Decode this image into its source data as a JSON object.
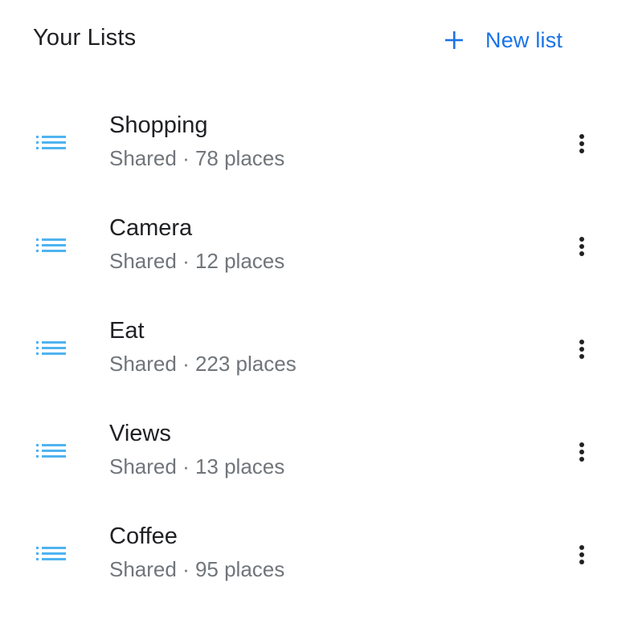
{
  "header": {
    "title": "Your Lists",
    "new_list_label": "New list",
    "new_list_icon": "plus-icon"
  },
  "colors": {
    "accent": "#1a73e8",
    "list_icon": "#4fb3f0",
    "title_text": "#202124",
    "meta_text": "#70757a",
    "more_icon": "#202124"
  },
  "lists": [
    {
      "name": "Shopping",
      "meta": "Shared · 78 places",
      "icon": "list-icon",
      "menu_icon": "more-vert-icon"
    },
    {
      "name": "Camera",
      "meta": "Shared · 12 places",
      "icon": "list-icon",
      "menu_icon": "more-vert-icon"
    },
    {
      "name": "Eat",
      "meta": "Shared · 223 places",
      "icon": "list-icon",
      "menu_icon": "more-vert-icon"
    },
    {
      "name": "Views",
      "meta": "Shared · 13 places",
      "icon": "list-icon",
      "menu_icon": "more-vert-icon"
    },
    {
      "name": "Coffee",
      "meta": "Shared · 95 places",
      "icon": "list-icon",
      "menu_icon": "more-vert-icon"
    }
  ]
}
